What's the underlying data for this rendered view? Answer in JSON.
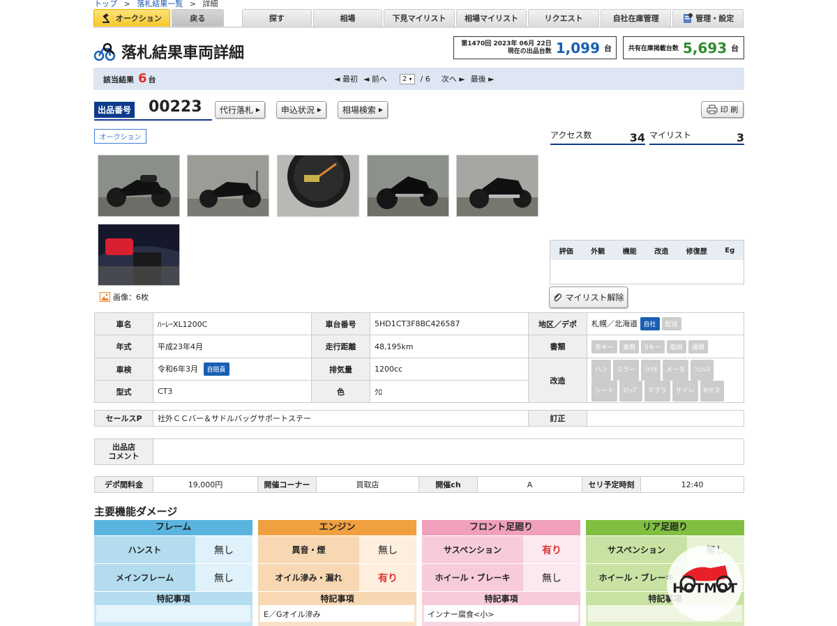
{
  "breadcrumb": {
    "top": "トップ",
    "sep1": ">",
    "list": "落札結果一覧",
    "sep2": ">",
    "current": "詳細"
  },
  "nav": {
    "auction": "オークション",
    "back": "戻る",
    "search": "探す",
    "market": "相場",
    "shitami": "下見マイリスト",
    "market_mylist": "相場マイリスト",
    "request": "リクエスト",
    "stock": "自社在庫管理",
    "admin": "管理・設定"
  },
  "title": "落札結果車両詳細",
  "session": {
    "line1": "第1470回 2023年 06月 22日",
    "line2": "現在の出品台数",
    "count": "1,099",
    "unit": "台"
  },
  "shared": {
    "label": "共有在庫掲載台数",
    "count": "5,693",
    "unit": "台"
  },
  "pager": {
    "hit_label": "該当結果",
    "hit_count": "6",
    "hit_unit": "台",
    "first": "◄ 最初",
    "prev": "◄ 前へ",
    "page": "2",
    "total": "/ 6",
    "next": "次へ ►",
    "last": "最後 ►"
  },
  "lot": {
    "label": "出品番号",
    "number": "00223",
    "btn_proxy": "代行落札",
    "btn_status": "申込状況",
    "btn_market": "相場検索",
    "print": "印 刷",
    "tag": "オークション"
  },
  "access": {
    "label": "アクセス数",
    "count": "34",
    "mylist_label": "マイリスト",
    "mylist_count": "3"
  },
  "images": {
    "label": "画像：6枚"
  },
  "eval": {
    "cols": [
      "評価",
      "外観",
      "機能",
      "改造",
      "修復歴",
      "Eg"
    ]
  },
  "mylist_btn": "マイリスト解除",
  "spec": {
    "name_h": "車名",
    "name": "ﾊｰﾚｰXL1200C",
    "frame_h": "車台番号",
    "frame": "5HD1CT3F8BC426587",
    "area_h": "地区／デポ",
    "area": "札幌／北海道",
    "area_tag1": "自社",
    "area_tag2": "配送",
    "year_h": "年式",
    "year": "平成23年4月",
    "mileage_h": "走行距離",
    "mileage": "48,195km",
    "docs_h": "書類",
    "docs": [
      "赤キー",
      "書類",
      "Sキー",
      "取説",
      "通関"
    ],
    "inspect_h": "車検",
    "inspect": "令和6年3月",
    "inspect_tag": "自賠責",
    "cc_h": "排気量",
    "cc": "1200cc",
    "mod_h": "改造",
    "mods": [
      "ハン",
      "ミラー",
      "ﾗｲﾀｵ",
      "メータ",
      "ﾌｪﾝﾚｽ",
      "シート",
      "ｽﾃｯﾌﾟ",
      "マフラ",
      "サイレ",
      "Rサス"
    ],
    "model_h": "型式",
    "model": "CT3",
    "color_h": "色",
    "color": "ｸﾛ"
  },
  "sales": {
    "h": "セールスP",
    "v": "社外ＣＣバー＆サドルバッグサポートステー",
    "fix_h": "訂正",
    "fix": ""
  },
  "comment": {
    "h1": "出品店",
    "h2": "コメント",
    "v": ""
  },
  "fees": {
    "depo_h": "デポ間料金",
    "depo": "19,000円",
    "corner_h": "開催コーナー",
    "corner": "買取店",
    "ch_h": "開催ch",
    "ch": "A",
    "time_h": "セリ予定時刻",
    "time": "12:40"
  },
  "damage": {
    "title": "主要機能ダメージ",
    "cols": [
      {
        "name": "フレーム",
        "k1": "ハンスト",
        "v1": "無し",
        "k2": "メインフレーム",
        "v2": "無し",
        "sp": "特記事項",
        "note": ""
      },
      {
        "name": "エンジン",
        "k1": "異音・煙",
        "v1": "無し",
        "k2": "オイル滲み・漏れ",
        "v2": "有り",
        "sp": "特記事項",
        "note": "E／Gオイル滲み"
      },
      {
        "name": "フロント足廻り",
        "k1": "サスペンション",
        "v1": "有り",
        "k2": "ホイール・ブレーキ",
        "v2": "無し",
        "sp": "特記事項",
        "note": "インナー腐食<小>"
      },
      {
        "name": "リア足廻り",
        "k1": "サスペンション",
        "v1": "無し",
        "k2": "ホイール・ブレーキ",
        "v2": "無し",
        "sp": "特記事項",
        "note": ""
      }
    ]
  },
  "watermark": "HOTMOT",
  "colors": {
    "navy": "#0d3b8c",
    "blue": "#1a5fb4",
    "green": "#2e8b2e",
    "red": "#e03030"
  }
}
